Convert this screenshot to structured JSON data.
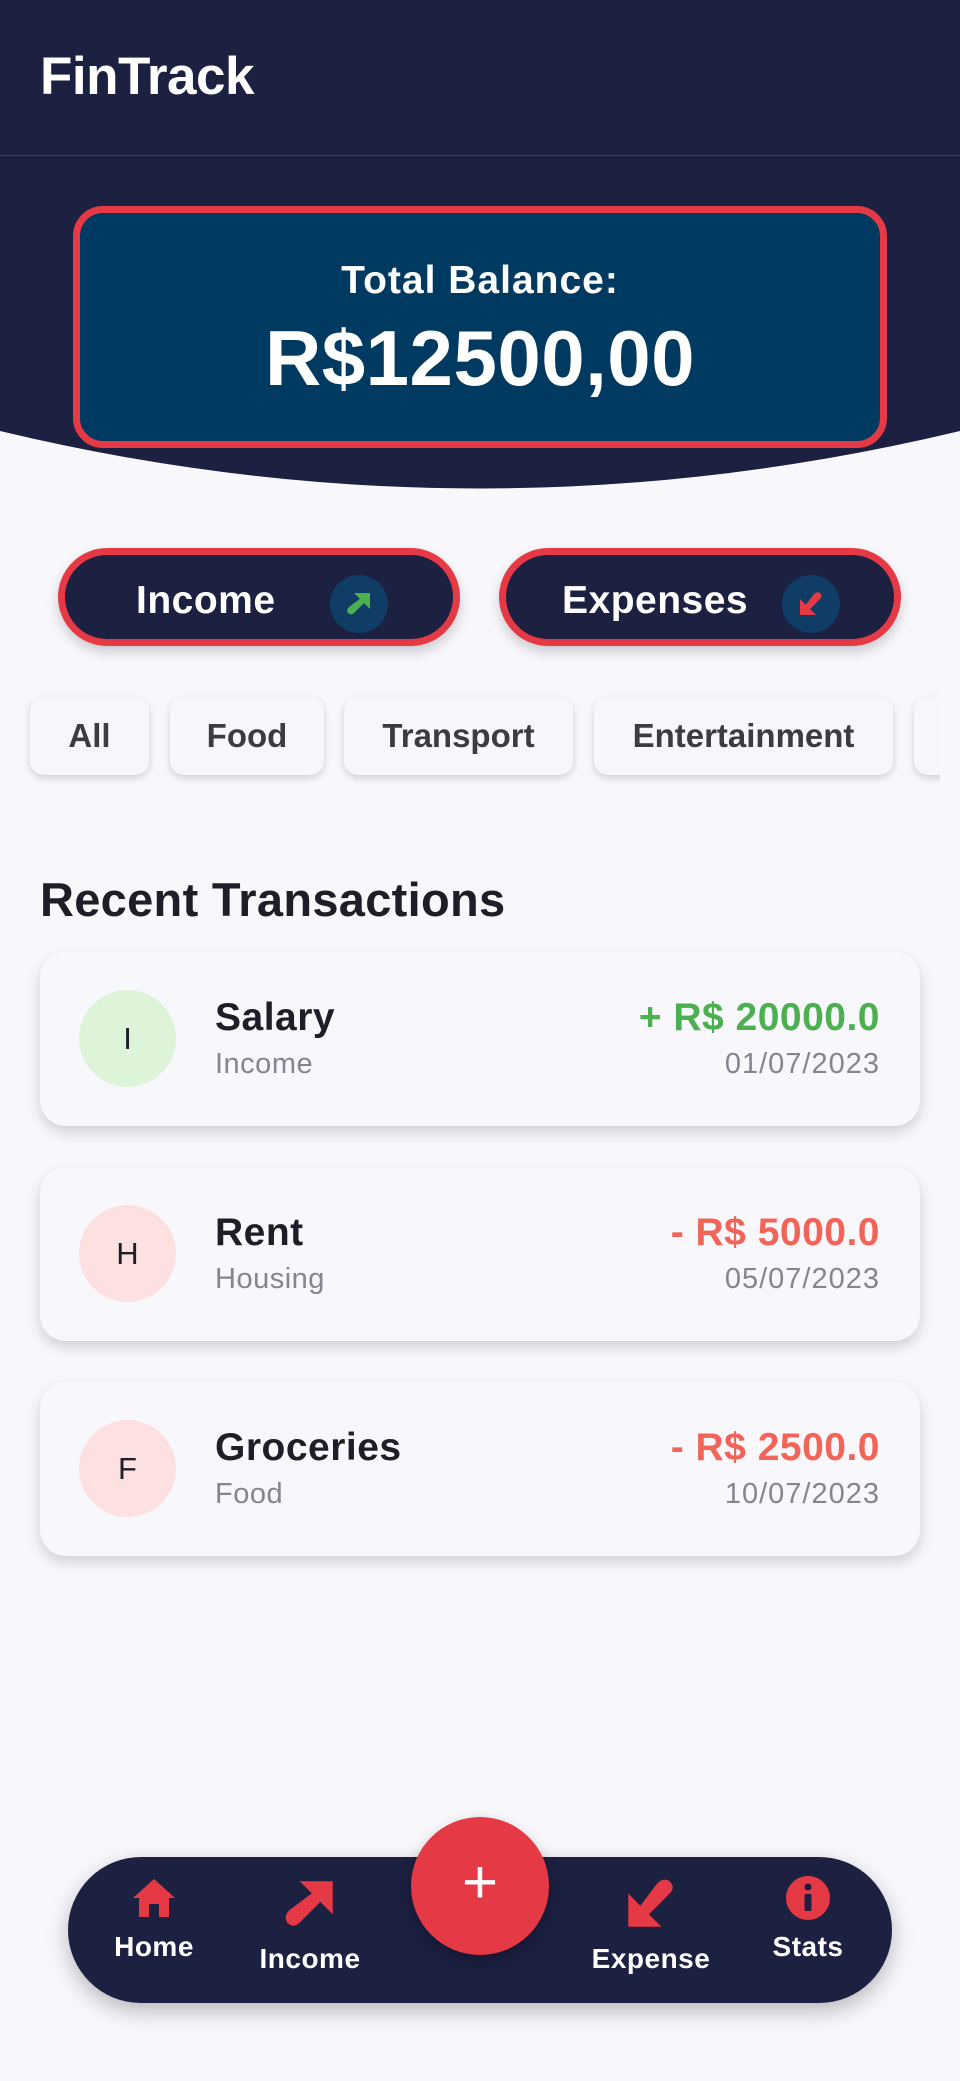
{
  "app": {
    "title": "FinTrack"
  },
  "balance": {
    "label": "Total Balance:",
    "value": "R$12500,00"
  },
  "actions": {
    "income_label": "Income",
    "expenses_label": "Expenses"
  },
  "categories": [
    "All",
    "Food",
    "Transport",
    "Entertainment"
  ],
  "recent": {
    "title": "Recent Transactions",
    "items": [
      {
        "initial": "I",
        "title": "Salary",
        "category": "Income",
        "amount": "+ R$ 20000.0",
        "date": "01/07/2023",
        "type": "income"
      },
      {
        "initial": "H",
        "title": "Rent",
        "category": "Housing",
        "amount": "- R$ 5000.0",
        "date": "05/07/2023",
        "type": "expense"
      },
      {
        "initial": "F",
        "title": "Groceries",
        "category": "Food",
        "amount": "- R$ 2500.0",
        "date": "10/07/2023",
        "type": "expense"
      }
    ]
  },
  "nav": {
    "home": "Home",
    "income": "Income",
    "add": "+",
    "expense": "Expense",
    "stats": "Stats"
  },
  "icons": {
    "income_arrow": "arrow-up-right-icon",
    "expense_arrow": "arrow-down-left-icon",
    "home": "home-icon",
    "stats": "info-icon"
  },
  "colors": {
    "primary_dark": "#1c2041",
    "accent": "#e63946",
    "balance_card": "#013a61",
    "income_green": "#4caf50",
    "expense_red": "#f26457",
    "income_avatar": "#ddf4d9",
    "expense_avatar": "#fde0e0"
  }
}
